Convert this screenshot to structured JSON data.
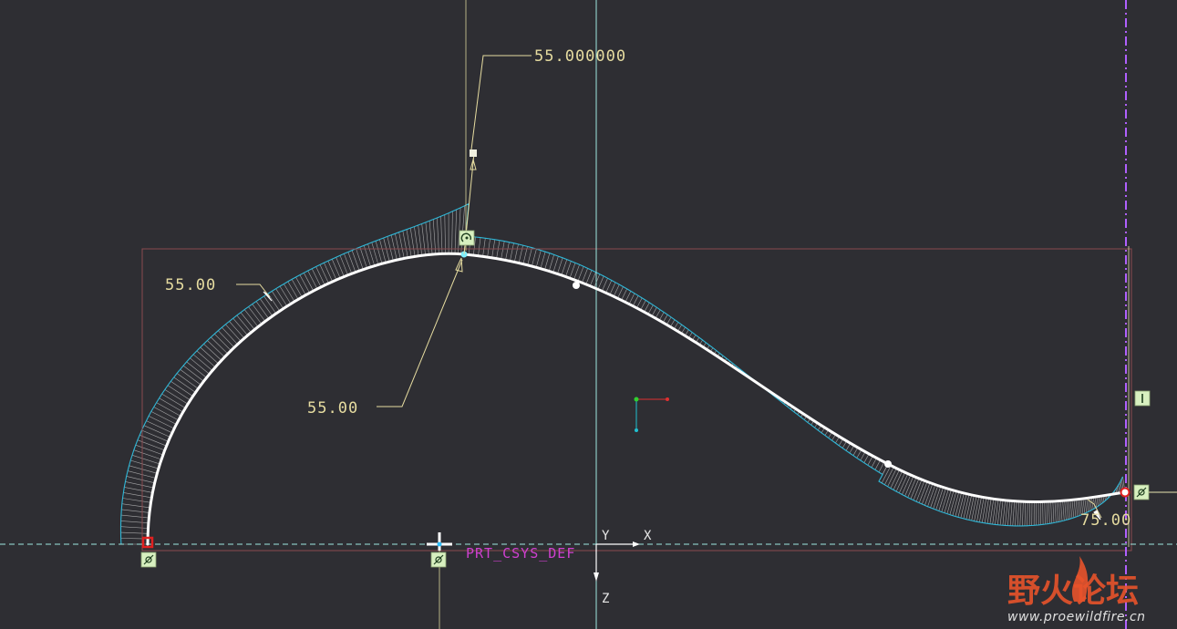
{
  "viewport": {
    "background": "#2e2e33"
  },
  "dimensions": {
    "top_value": "55.000000",
    "left_radius": "55.00",
    "center_radius": "55.00",
    "right_value": "75.00"
  },
  "axes": {
    "x_label": "X",
    "y_label": "Y",
    "z_label": "Z",
    "csys_name": "PRT_CSYS_DEF"
  },
  "watermark": {
    "brand": "野火论坛",
    "url": "www.proewildfire.cn"
  },
  "colors": {
    "curve": "#ffffff",
    "envelope": "#2fb8d8",
    "comb": "#cfcfcf",
    "dimension": "#e6dca0",
    "sketch_box": "#8a4b4f",
    "datum_plane": "#b060ff",
    "csys": "#d040d0",
    "axis_line": "#9fe8e0",
    "constraint_box": "#d8f0c0",
    "endpoint": "#e02020"
  },
  "icons": {
    "tangent_constraint": "tangent-icon",
    "vertical_constraint": "vertical-icon",
    "curvature_constraint": "curvature-icon"
  }
}
